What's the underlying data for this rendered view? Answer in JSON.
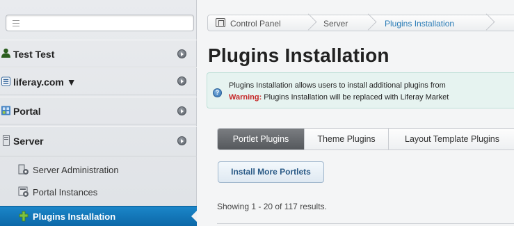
{
  "sidebar": {
    "search": {
      "value": "",
      "placeholder": ""
    },
    "sections": [
      {
        "label": "Test Test",
        "icon": "user-icon"
      },
      {
        "label": "liferay.com ▼",
        "icon": "site-icon"
      },
      {
        "label": "Portal",
        "icon": "portal-icon"
      },
      {
        "label": "Server",
        "icon": "server-icon"
      }
    ],
    "server_items": [
      {
        "label": "Server Administration",
        "icon": "server-admin-icon"
      },
      {
        "label": "Portal Instances",
        "icon": "portal-instances-icon"
      },
      {
        "label": "Plugins Installation",
        "icon": "plugins-icon",
        "active": true
      }
    ]
  },
  "breadcrumb": [
    "Control Panel",
    "Server",
    "Plugins Installation"
  ],
  "page": {
    "title": "Plugins Installation",
    "alert": {
      "line1": "Plugins Installation allows users to install additional plugins from",
      "warning_label": "Warning:",
      "line2": " Plugins Installation will be replaced with Liferay Market"
    },
    "tabs": [
      "Portlet Plugins",
      "Theme Plugins",
      "Layout Template Plugins"
    ],
    "active_tab": "Portlet Plugins",
    "install_button": "Install More Portlets",
    "showing": "Showing 1 - 20 of 117 results."
  },
  "colors": {
    "accent": "#1b86c9",
    "warning": "#c62828",
    "alert_bg": "#e6f3f0"
  }
}
